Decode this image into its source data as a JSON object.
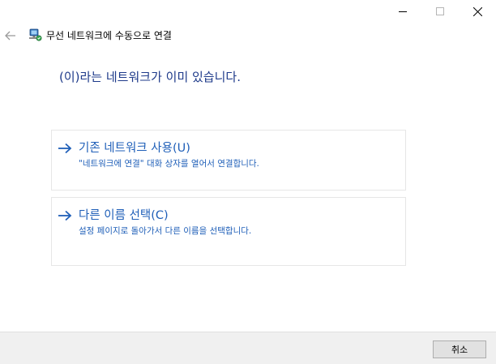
{
  "window": {
    "title": "무선 네트워크에 수동으로 연결",
    "controls": {
      "minimize": "minimize",
      "maximize": "maximize",
      "close": "close"
    }
  },
  "heading": "(이)라는 네트워크가 이미 있습니다.",
  "options": [
    {
      "title": "기존 네트워크 사용(U)",
      "description": "\"네트워크에 연결\" 대화 상자를 열어서 연결합니다."
    },
    {
      "title": "다른 이름 선택(C)",
      "description": "설정 페이지로 돌아가서 다른 이름을 선택합니다."
    }
  ],
  "footer": {
    "cancel_label": "취소"
  },
  "icons": {
    "back": "back-arrow-icon",
    "app": "network-connection-icon",
    "option": "right-arrow-icon"
  },
  "colors": {
    "heading": "#1e3a8a",
    "link": "#1f5fb8",
    "footer_bg": "#f0f0f0"
  }
}
